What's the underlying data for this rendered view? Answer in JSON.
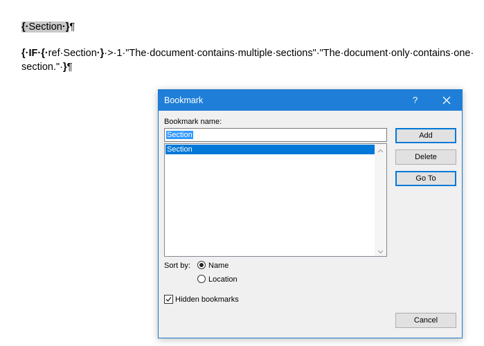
{
  "document": {
    "line1": {
      "field_open": "{·",
      "text": "Section",
      "field_close": "·}",
      "pilcrow": "¶"
    },
    "line2": {
      "field_open": "{·IF·",
      "inner_open": "{·",
      "inner_text": "ref·Section",
      "inner_close": "·}",
      "text": "·>·1·\"The·document·contains·multiple·sections\"·\"The·document·only·contains·one·"
    },
    "line3": {
      "text": "section.\"·",
      "field_close": "}",
      "pilcrow": "¶"
    }
  },
  "dialog": {
    "title": "Bookmark",
    "help_label": "?",
    "bookmark_name_label": "Bookmark name:",
    "name_value": "Section",
    "list_items": [
      "Section"
    ],
    "buttons": {
      "add": "Add",
      "delete": "Delete",
      "goto": "Go To",
      "cancel": "Cancel"
    },
    "sort_by_label": "Sort by:",
    "sort_options": {
      "name": "Name",
      "location": "Location"
    },
    "sort_selected": "Name",
    "hidden_bookmarks_label": "Hidden bookmarks",
    "hidden_bookmarks_checked": true
  },
  "colors": {
    "titlebar": "#1f7fd8",
    "selection": "#0078d7",
    "field_shading": "#c8c8c8"
  }
}
